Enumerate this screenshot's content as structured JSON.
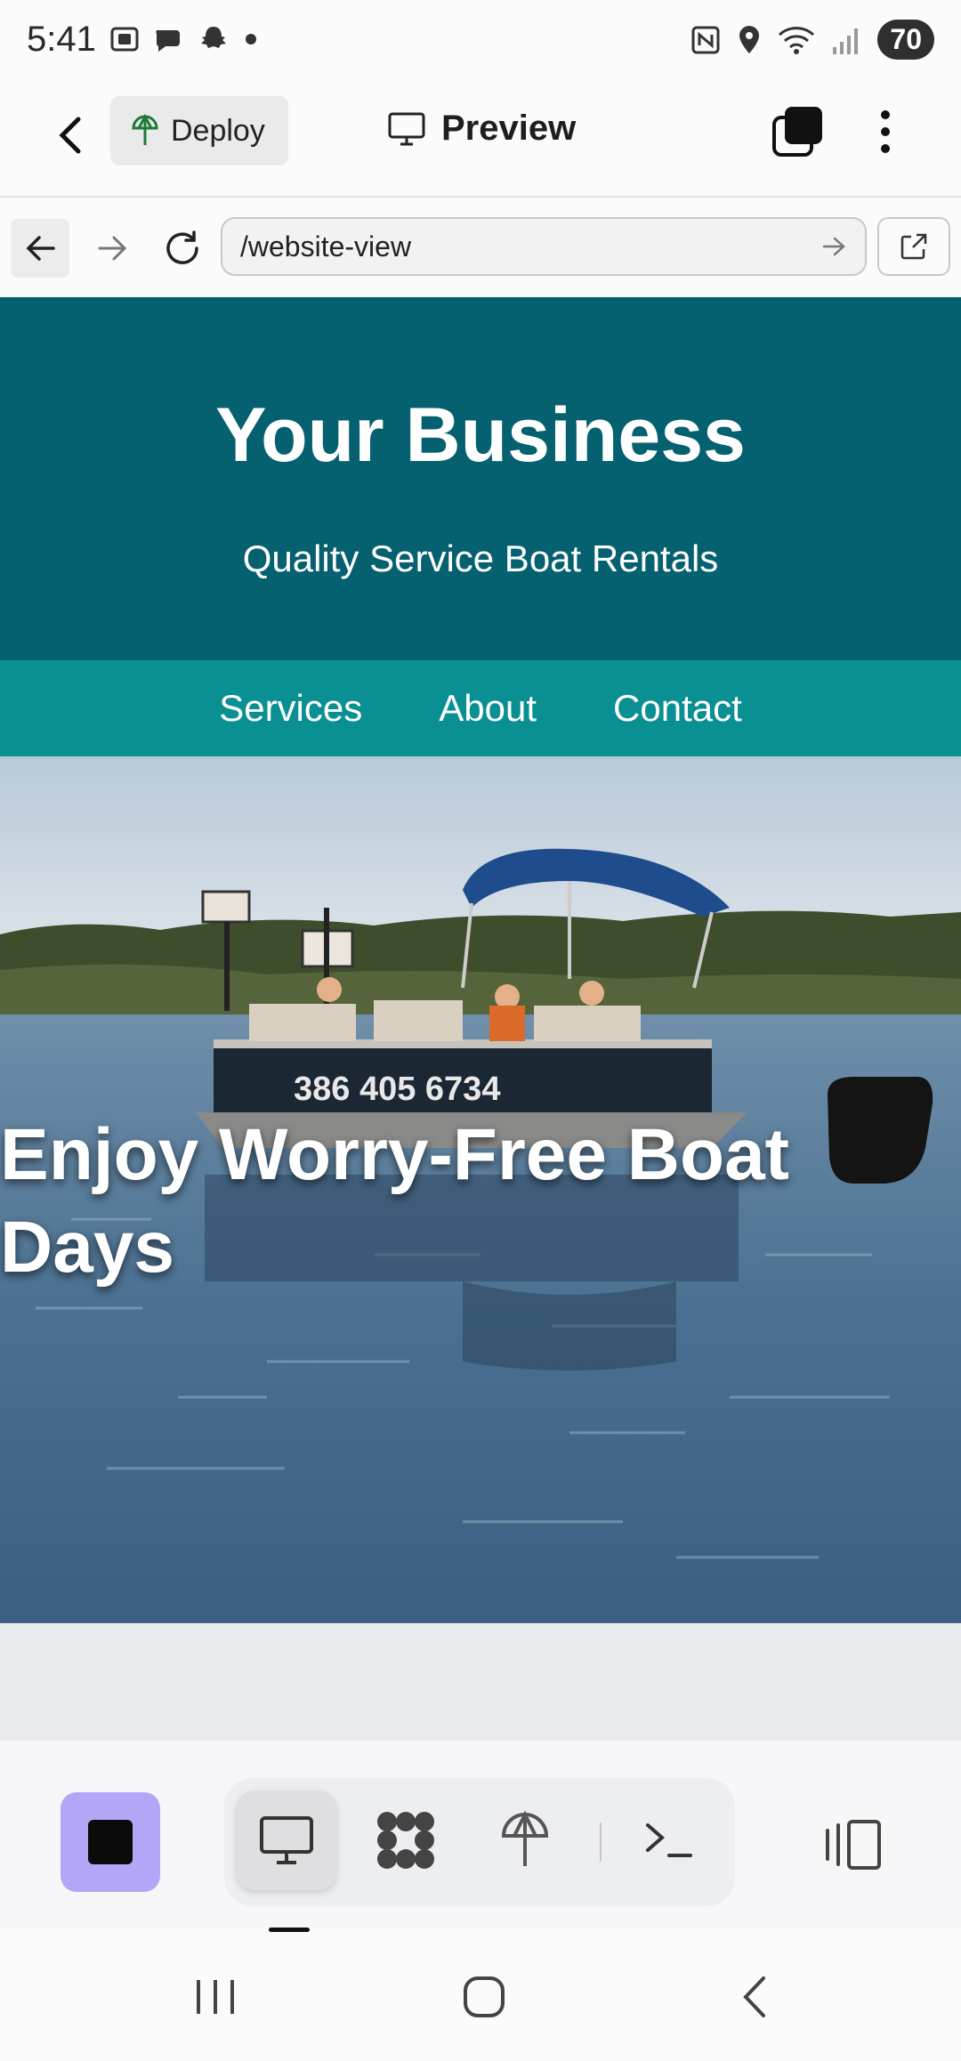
{
  "status_bar": {
    "time": "5:41",
    "battery": "70",
    "left_icons": [
      "screenshot-icon",
      "chat-icon",
      "snapchat-icon",
      "dot-icon"
    ],
    "right_icons": [
      "nfc-icon",
      "location-icon",
      "wifi-icon",
      "signal-icon"
    ]
  },
  "toolbar": {
    "back_icon": "chevron-left-icon",
    "deploy_label": "Deploy",
    "preview_label": "Preview"
  },
  "browser": {
    "url": "/website-view"
  },
  "site": {
    "title": "Your Business",
    "tagline": "Quality Service Boat Rentals",
    "nav": [
      "Services",
      "About",
      "Contact"
    ],
    "hero_heading": "Enjoy Worry-Free Boat Days",
    "hero_image": "pontoon-boat-photo",
    "colors": {
      "header_bg": "#05606f",
      "nav_bg": "#0a8f93"
    }
  },
  "dock": {
    "accent": "#b4a6f7",
    "items": [
      "monitor-icon",
      "grid-icon",
      "deploy-icon",
      "terminal-icon"
    ],
    "active_item": "monitor-icon"
  }
}
